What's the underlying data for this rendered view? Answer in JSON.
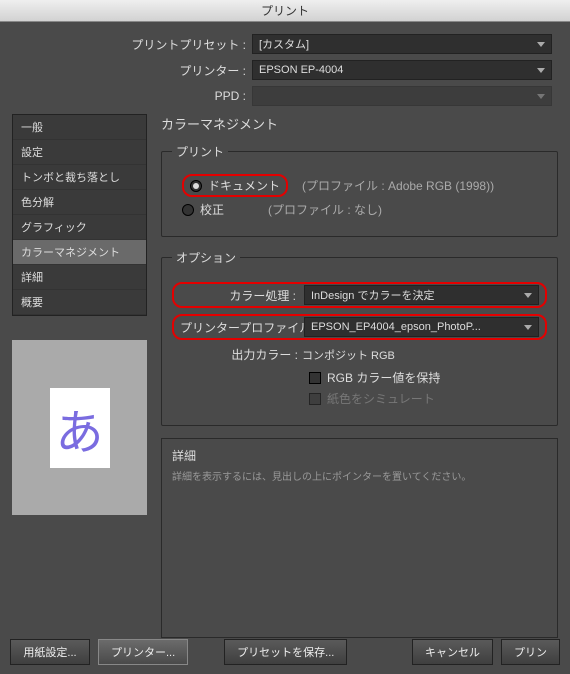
{
  "title": "プリント",
  "header": {
    "preset_label": "プリントプリセット :",
    "preset_value": "[カスタム]",
    "printer_label": "プリンター :",
    "printer_value": "EPSON EP-4004",
    "ppd_label": "PPD :",
    "ppd_value": ""
  },
  "sidebar": {
    "items": [
      {
        "label": "一般"
      },
      {
        "label": "設定"
      },
      {
        "label": "トンボと裁ち落とし"
      },
      {
        "label": "色分解"
      },
      {
        "label": "グラフィック"
      },
      {
        "label": "カラーマネジメント",
        "selected": true
      },
      {
        "label": "詳細"
      },
      {
        "label": "概要"
      }
    ]
  },
  "preview": {
    "glyph": "あ"
  },
  "content": {
    "panel_title": "カラーマネジメント",
    "print_group": {
      "legend": "プリント",
      "document_label": "ドキュメント",
      "document_profile": "(プロファイル : Adobe RGB (1998))",
      "proof_label": "校正",
      "proof_profile": "(プロファイル : なし)"
    },
    "options_group": {
      "legend": "オプション",
      "color_handling_label": "カラー処理 :",
      "color_handling_value": "InDesign でカラーを決定",
      "printer_profile_label": "プリンタープロファイル :",
      "printer_profile_value": "EPSON_EP4004_epson_PhotoP...",
      "output_color_label": "出力カラー :",
      "output_color_value": "コンポジット RGB",
      "preserve_rgb_label": "RGB カラー値を保持",
      "simulate_paper_label": "紙色をシミュレート"
    },
    "detail_box": {
      "title": "詳細",
      "text": "詳細を表示するには、見出しの上にポインターを置いてください。"
    }
  },
  "buttons": {
    "page_setup": "用紙設定...",
    "printer": "プリンター...",
    "save_preset": "プリセットを保存...",
    "cancel": "キャンセル",
    "print": "プリン"
  }
}
